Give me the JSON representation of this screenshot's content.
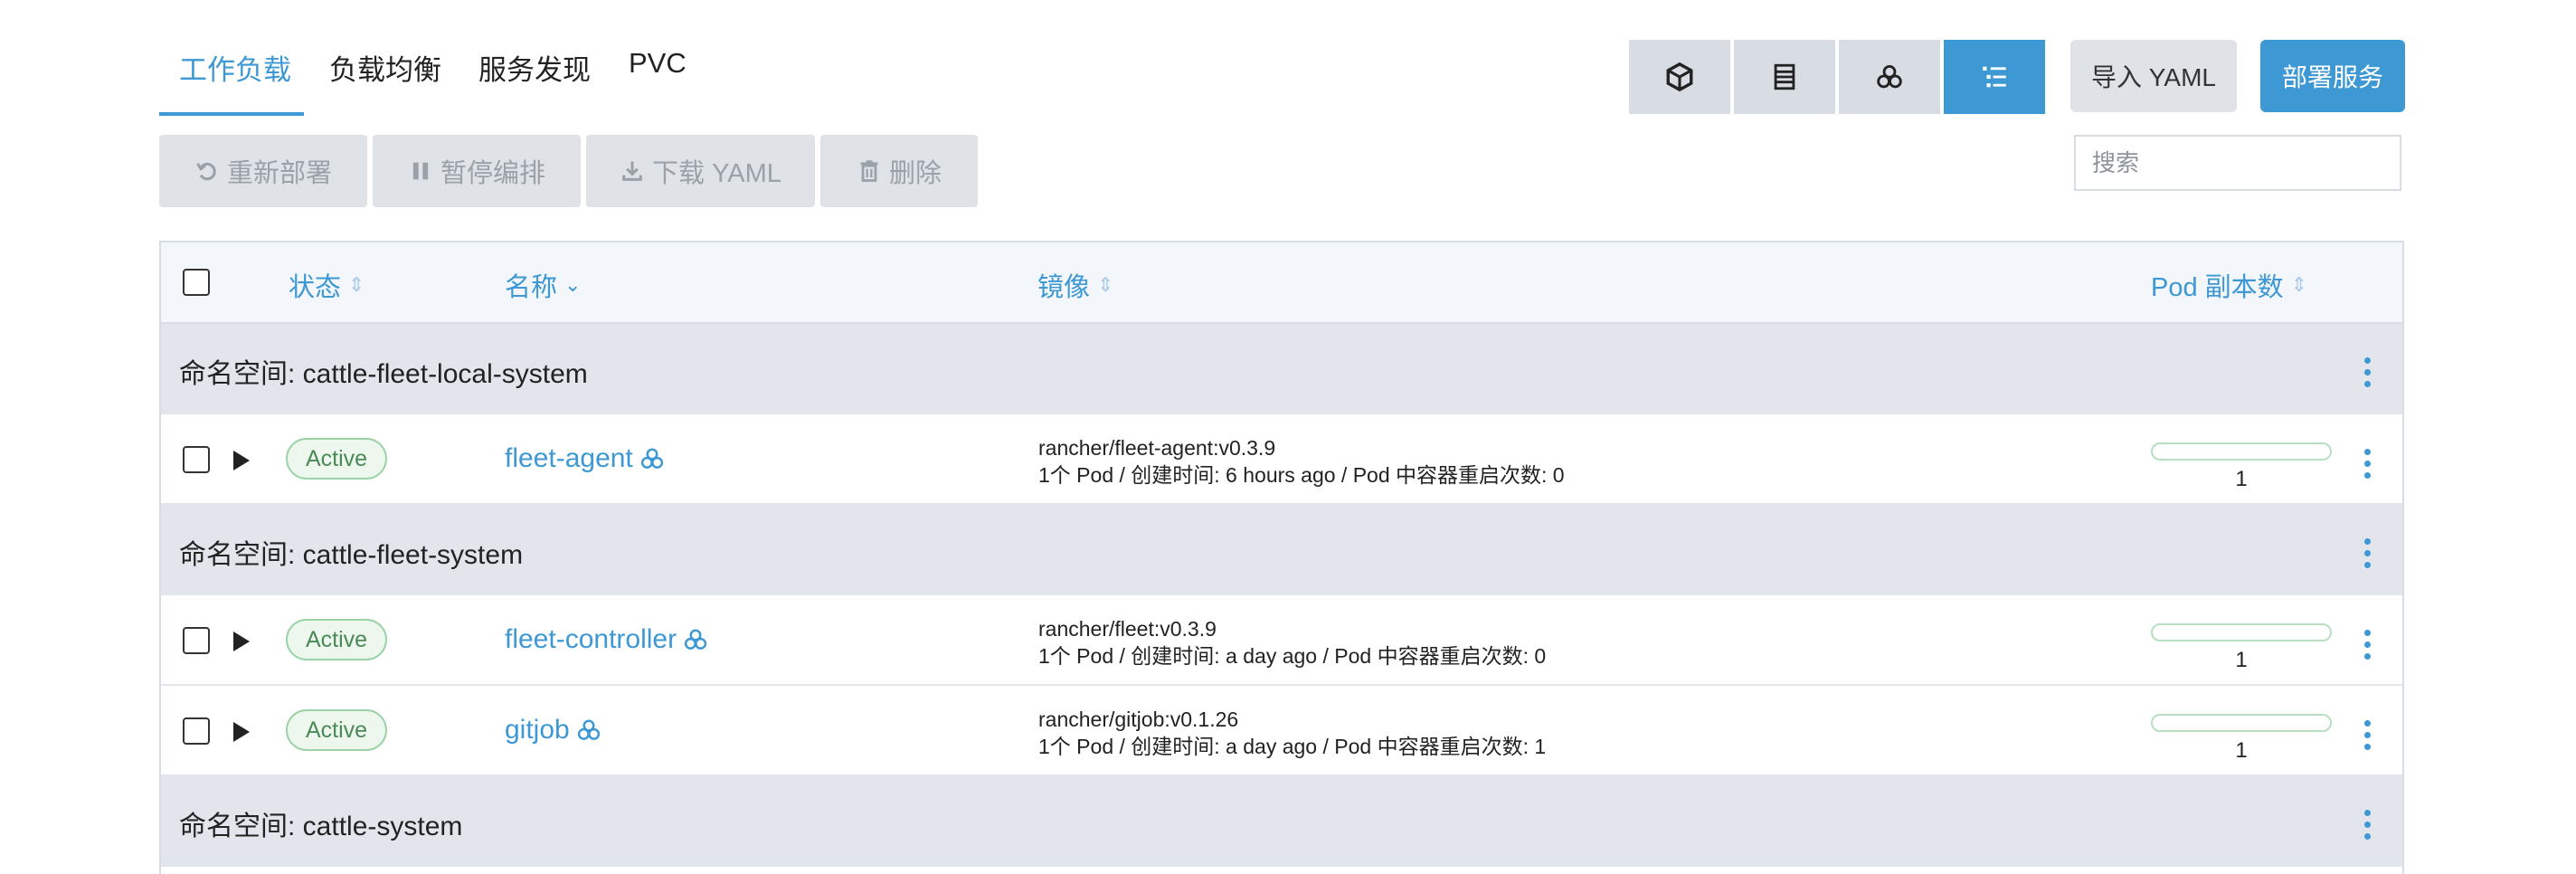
{
  "tabs": [
    {
      "label": "工作负载",
      "active": true
    },
    {
      "label": "负载均衡",
      "active": false
    },
    {
      "label": "服务发现",
      "active": false
    },
    {
      "label": "PVC",
      "active": false
    }
  ],
  "view_toggles": [
    {
      "icon": "cube-icon",
      "active": false
    },
    {
      "icon": "server-icon",
      "active": false
    },
    {
      "icon": "cluster-icon",
      "active": false
    },
    {
      "icon": "list-tree-icon",
      "active": true
    }
  ],
  "header_buttons": {
    "import_yaml": "导入 YAML",
    "deploy": "部署服务"
  },
  "actions": {
    "redeploy": "重新部署",
    "pause": "暂停编排",
    "download_yaml": "下载 YAML",
    "delete": "删除"
  },
  "search": {
    "placeholder": "搜索"
  },
  "table": {
    "columns": {
      "state": "状态",
      "name": "名称",
      "image": "镜像",
      "pods": "Pod 副本数"
    },
    "groups": [
      {
        "label": "命名空间: cattle-fleet-local-system",
        "rows": [
          {
            "state": "Active",
            "name": "fleet-agent",
            "image": "rancher/fleet-agent:v0.3.9",
            "detail": "1个 Pod / 创建时间: 6 hours ago / Pod 中容器重启次数: 0",
            "pods": "1"
          }
        ]
      },
      {
        "label": "命名空间: cattle-fleet-system",
        "rows": [
          {
            "state": "Active",
            "name": "fleet-controller",
            "image": "rancher/fleet:v0.3.9",
            "detail": "1个 Pod / 创建时间: a day ago / Pod 中容器重启次数: 0",
            "pods": "1"
          },
          {
            "state": "Active",
            "name": "gitjob",
            "image": "rancher/gitjob:v0.1.26",
            "detail": "1个 Pod / 创建时间: a day ago / Pod 中容器重启次数: 1",
            "pods": "1"
          }
        ]
      },
      {
        "label": "命名空间: cattle-system",
        "rows": []
      }
    ]
  },
  "colors": {
    "accent": "#3d98d3",
    "active_badge": "#4a8a57",
    "group_bg": "#e2e6ec"
  }
}
